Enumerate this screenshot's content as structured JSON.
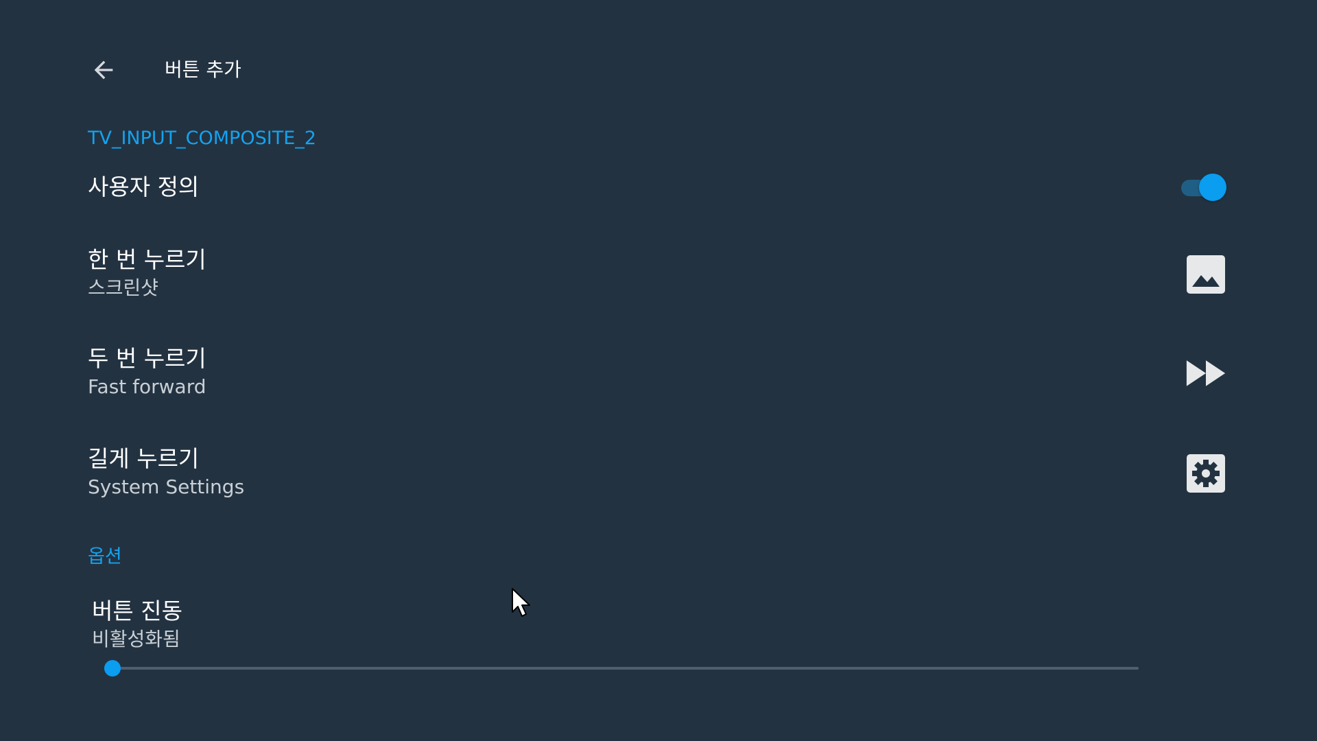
{
  "header": {
    "title": "버튼 추가",
    "back_icon": "arrow-back-icon"
  },
  "section_input": {
    "label": "TV_INPUT_COMPOSITE_2"
  },
  "custom_row": {
    "title": "사용자 정의",
    "toggle_on": true
  },
  "single_press": {
    "title": "한 번 누르기",
    "subtitle": "스크린샷",
    "icon": "image-icon"
  },
  "double_press": {
    "title": "두 번 누르기",
    "subtitle": "Fast forward",
    "icon": "fast-forward-icon"
  },
  "long_press": {
    "title": "길게 누르기",
    "subtitle": "System Settings",
    "icon": "gear-icon"
  },
  "section_options": {
    "label": "옵션"
  },
  "vibration": {
    "title": "버튼 진동",
    "subtitle": "비활성화됨",
    "slider_value": 0.0
  },
  "colors": {
    "background": "#233241",
    "accent": "#13a3f0",
    "toggle_track": "#1f5f85"
  }
}
